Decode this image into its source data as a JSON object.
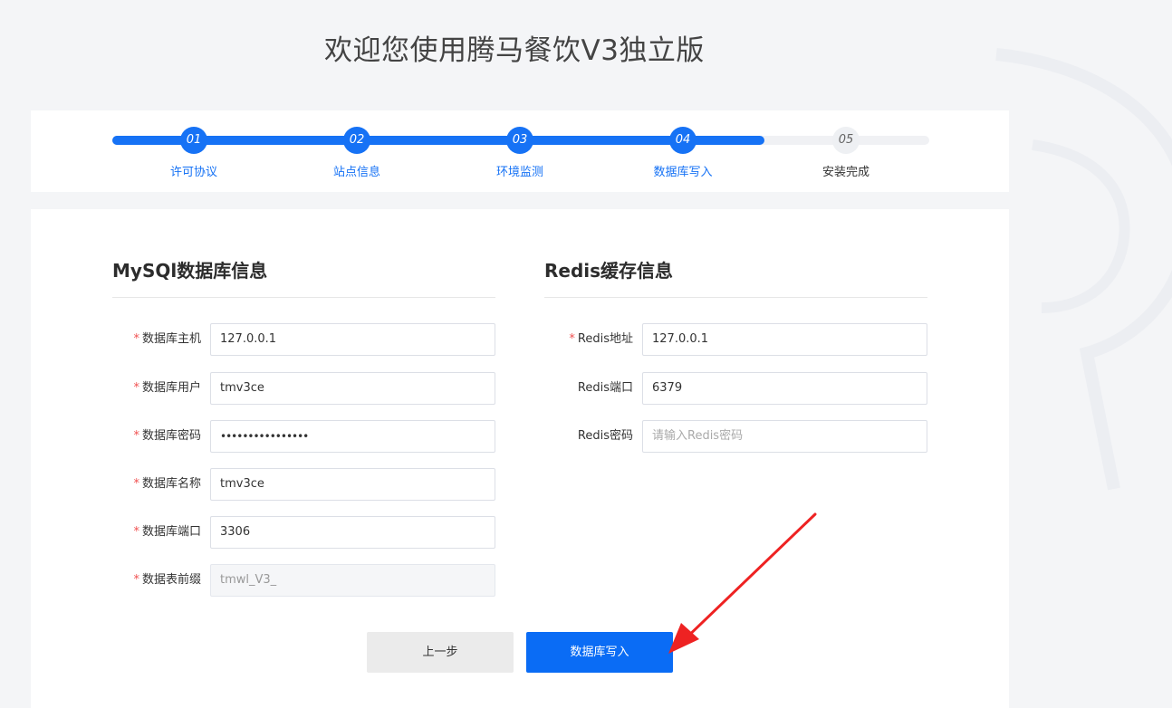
{
  "page_title": "欢迎您使用腾马餐饮V3独立版",
  "colors": {
    "accent": "#1672f5",
    "arrow": "#ee2222",
    "background": "#f4f5f7"
  },
  "steps": [
    {
      "number": "01",
      "label": "许可协议",
      "state": "done"
    },
    {
      "number": "02",
      "label": "站点信息",
      "state": "done"
    },
    {
      "number": "03",
      "label": "环境监测",
      "state": "done"
    },
    {
      "number": "04",
      "label": "数据库写入",
      "state": "active"
    },
    {
      "number": "05",
      "label": "安装完成",
      "state": "todo"
    }
  ],
  "mysql": {
    "title": "MySQl数据库信息",
    "fields": [
      {
        "label": "数据库主机",
        "required": "*",
        "value": "127.0.0.1"
      },
      {
        "label": "数据库用户",
        "required": "*",
        "value": "tmv3ce"
      },
      {
        "label": "数据库密码",
        "required": "*",
        "value": "••••••••••••••••"
      },
      {
        "label": "数据库名称",
        "required": "*",
        "value": "tmv3ce"
      },
      {
        "label": "数据库端口",
        "required": "*",
        "value": "3306"
      },
      {
        "label": "数据表前缀",
        "required": "*",
        "value": "tmwl_V3_"
      }
    ]
  },
  "redis": {
    "title": "Redis缓存信息",
    "fields": [
      {
        "label": "Redis地址",
        "required": "*",
        "value": "127.0.0.1"
      },
      {
        "label": "Redis端口",
        "value": "6379"
      },
      {
        "label": "Redis密码",
        "value": "",
        "placeholder": "请输入Redis密码"
      }
    ]
  },
  "buttons": {
    "prev": "上一步",
    "next": "数据库写入"
  }
}
